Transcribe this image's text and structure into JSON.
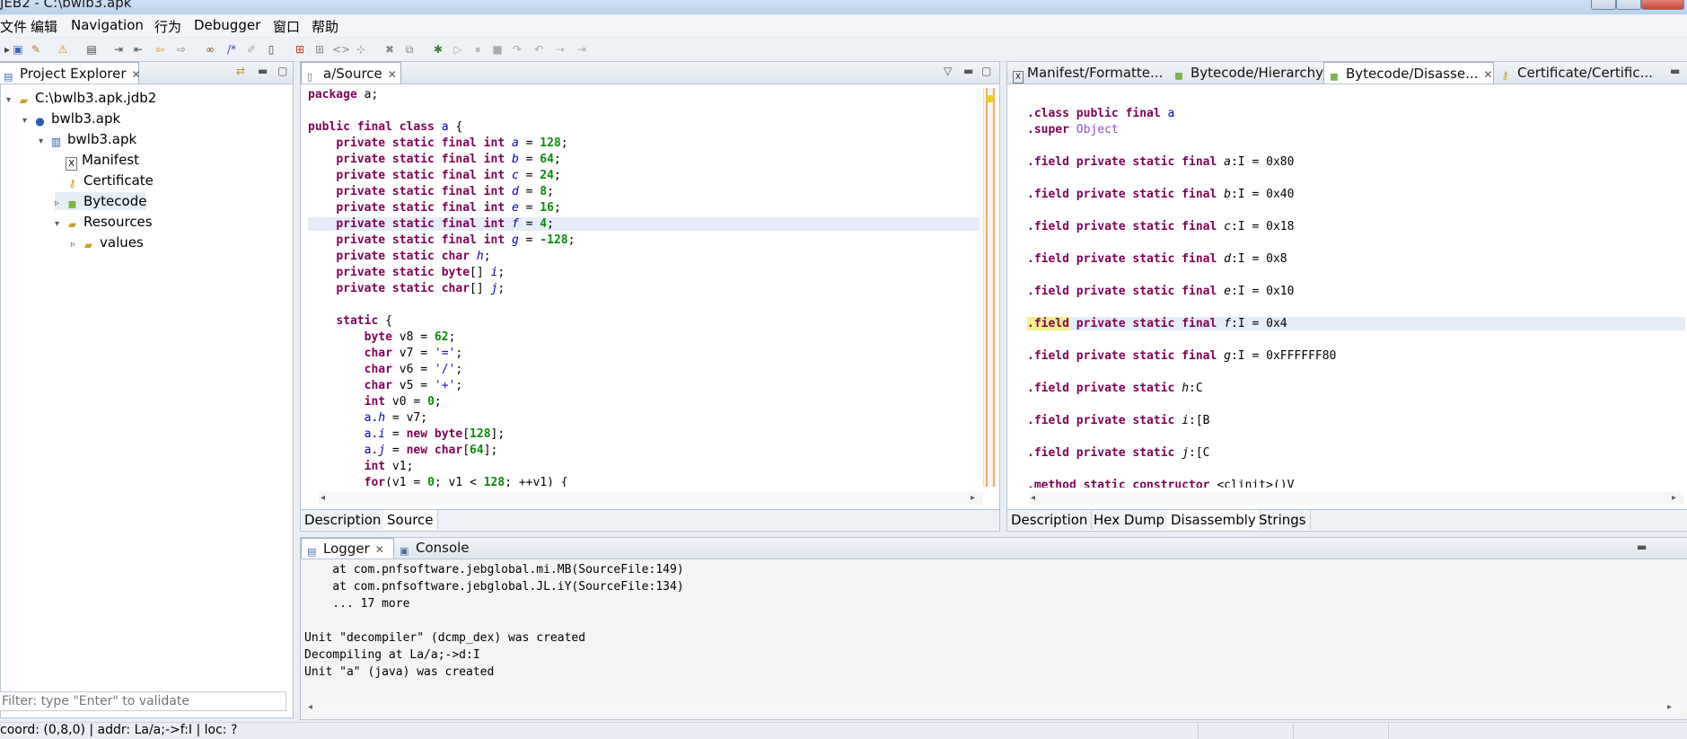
{
  "window": {
    "title": "JEB2 - C:\\bwlb3.apk"
  },
  "menu": [
    "文件",
    "编辑",
    "Navigation",
    "行为",
    "Debugger",
    "窗口",
    "帮助"
  ],
  "project_explorer": {
    "title": "Project Explorer",
    "tree": [
      {
        "label": "C:\\bwlb3.apk.jdb2",
        "icon": "folder-open-icon",
        "twisty": "▾"
      },
      {
        "label": "bwlb3.apk",
        "icon": "apk-icon",
        "twisty": "▾"
      },
      {
        "label": "bwlb3.apk",
        "icon": "package-icon",
        "twisty": "▾"
      },
      {
        "label": "Manifest",
        "icon": "manifest-icon",
        "twisty": ""
      },
      {
        "label": "Certificate",
        "icon": "certificate-icon",
        "twisty": ""
      },
      {
        "label": "Bytecode",
        "icon": "android-icon",
        "twisty": "▹"
      },
      {
        "label": "Resources",
        "icon": "folder-open-icon",
        "twisty": "▾"
      },
      {
        "label": "values",
        "icon": "folder-open-icon",
        "twisty": "▹"
      }
    ],
    "filter_placeholder": "Filter: type \"Enter\" to validate"
  },
  "source_editor": {
    "tab": "a/Source",
    "lines": [
      "package a;",
      "",
      "public final class a {",
      "    private static final int a = 128;",
      "    private static final int b = 64;",
      "    private static final int c = 24;",
      "    private static final int d = 8;",
      "    private static final int e = 16;",
      "    private static final int f = 4;",
      "    private static final int g = -128;",
      "    private static char h;",
      "    private static byte[] i;",
      "    private static char[] j;",
      "",
      "    static {",
      "        byte v8 = 62;",
      "        char v7 = '=';",
      "        char v6 = '/';",
      "        char v5 = '+';",
      "        int v0 = 0;",
      "        a.h = v7;",
      "        a.i = new byte[128];",
      "        a.j = new char[64];",
      "        int v1;",
      "        for(v1 = 0; v1 < 128; ++v1) {"
    ],
    "bottom_tabs": [
      "Description",
      "Source"
    ]
  },
  "right_panel": {
    "tabs": [
      "Manifest/Formatte...",
      "Bytecode/Hierarchy",
      "Bytecode/Disasse...",
      "Certificate/Certific..."
    ],
    "lines": [
      ".class public final a",
      ".super Object",
      "",
      ".field private static final a:I = 0x80",
      "",
      ".field private static final b:I = 0x40",
      "",
      ".field private static final c:I = 0x18",
      "",
      ".field private static final d:I = 0x8",
      "",
      ".field private static final e:I = 0x10",
      "",
      ".field private static final f:I = 0x4",
      "",
      ".field private static final g:I = 0xFFFFFF80",
      "",
      ".field private static h:C",
      "",
      ".field private static i:[B",
      "",
      ".field private static j:[C",
      "",
      ".method static constructor <clinit>()V"
    ],
    "bottom_tabs": [
      "Description",
      "Hex Dump",
      "Disassembly",
      "Strings"
    ]
  },
  "logger": {
    "tabs": [
      "Logger",
      "Console"
    ],
    "lines": [
      "    at com.pnfsoftware.jebglobal.mi.MB(SourceFile:149)",
      "    at com.pnfsoftware.jebglobal.JL.iY(SourceFile:134)",
      "    ... 17 more",
      "",
      "Unit \"decompiler\" (dcmp_dex) was created",
      "Decompiling at La/a;->d:I",
      "Unit \"a\" (java) was created"
    ]
  },
  "status_bar": {
    "text": "coord: (0,8,0) | addr: La/a;->f:I | loc: ?"
  }
}
